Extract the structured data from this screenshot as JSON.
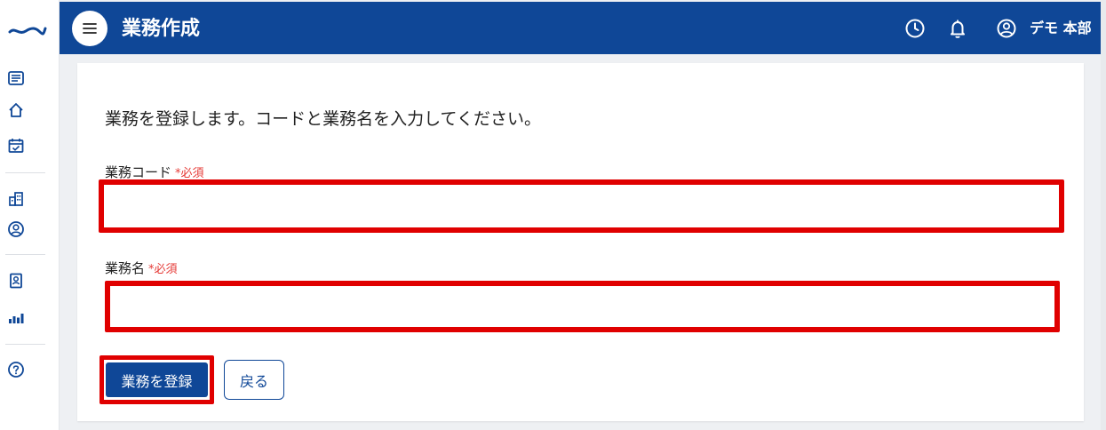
{
  "header": {
    "title": "業務作成",
    "user_name": "デモ 本部"
  },
  "sidebar": {
    "icons": [
      "list-icon",
      "home-icon",
      "calendar-check-icon",
      "building-icon",
      "user-circle-icon",
      "id-badge-icon",
      "bar-chart-icon",
      "help-icon"
    ]
  },
  "form": {
    "intro": "業務を登録します。コードと業務名を入力してください。",
    "code_label": "業務コード",
    "name_label": "業務名",
    "required_mark": "*必須",
    "code_value": "",
    "name_value": "",
    "submit_label": "業務を登録",
    "back_label": "戻る"
  },
  "colors": {
    "primary": "#0f4797",
    "required": "#e53935",
    "highlight": "#e00000"
  }
}
